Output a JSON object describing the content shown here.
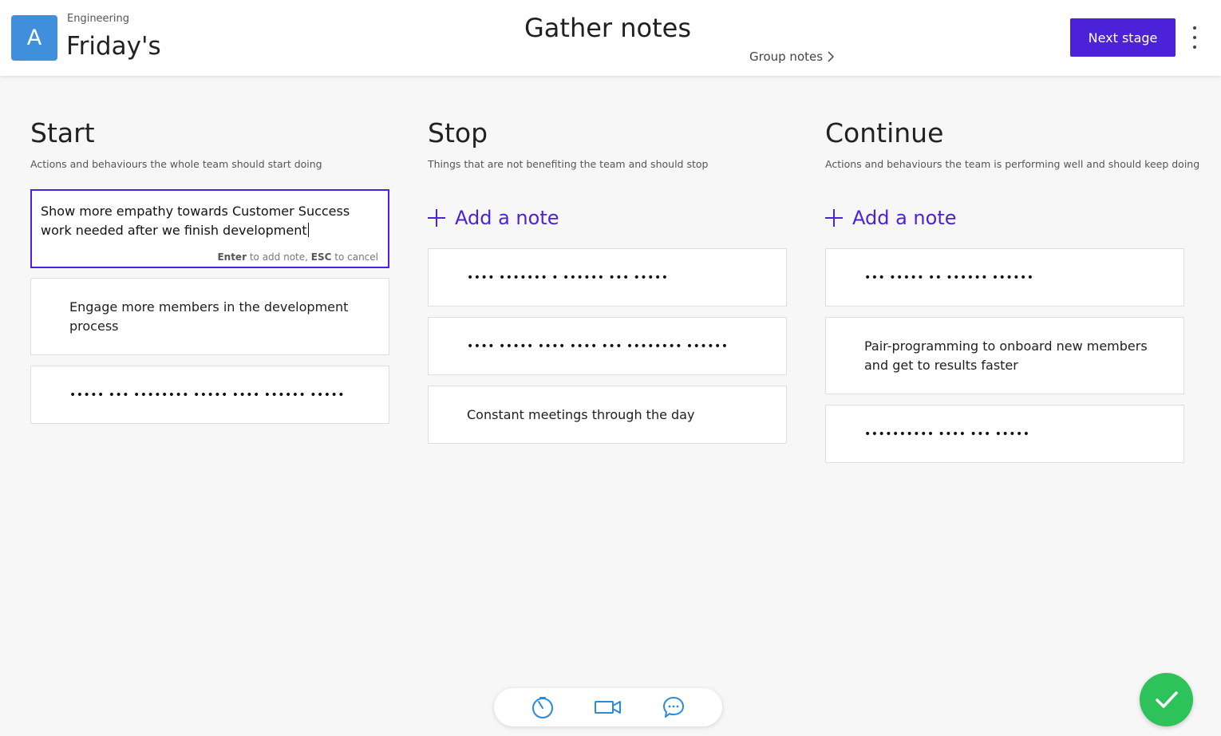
{
  "header": {
    "avatar_letter": "A",
    "team_name": "Engineering",
    "board_name": "Friday's",
    "stage_title": "Gather notes",
    "group_notes_label": "Group notes",
    "next_stage_label": "Next stage"
  },
  "columns": [
    {
      "title": "Start",
      "description": "Actions and behaviours the whole team should start doing",
      "editor": {
        "value": "Show more empathy towards Customer Success work needed after we finish development",
        "hint_key1": "Enter",
        "hint_text1": "to add note,",
        "hint_key2": "ESC",
        "hint_text2": "to cancel"
      },
      "notes": [
        "Engage more members in the development process",
        "••••• ••• •••••••• ••••• •••• •••••• •••••"
      ]
    },
    {
      "title": "Stop",
      "description": "Things that are not benefiting the team and should stop",
      "add_note_label": "Add a note",
      "notes": [
        "•••• ••••••• • •••••• ••• •••••",
        "•••• ••••• •••• •••• ••• •••••••• ••••••",
        "Constant meetings through the day"
      ]
    },
    {
      "title": "Continue",
      "description": "Actions and behaviours the team is performing well and should keep doing",
      "add_note_label": "Add a note",
      "notes": [
        "••• ••••• •• •••••• ••••••",
        "Pair-programming to onboard new members and get to results faster",
        "•••••••••• •••• ••• •••••"
      ]
    }
  ],
  "toolbar": {
    "icons": [
      "timer-icon",
      "video-icon",
      "chat-icon"
    ]
  },
  "colors": {
    "accent": "#4b22d9",
    "avatar": "#3f8fdd",
    "success": "#2ec25a",
    "toolbar_icon": "#2a8bd6"
  }
}
